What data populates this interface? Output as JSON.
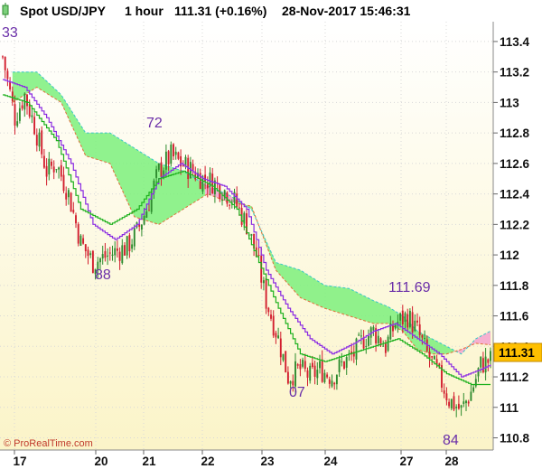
{
  "header": {
    "symbol": "Spot USD/JPY",
    "timeframe": "1 hour",
    "price_change": "111.31 (+0.16%)",
    "datetime": "28-Nov-2017 15:46:31"
  },
  "copyright": "© ProRealTime.com",
  "colors": {
    "candle_up": "#2e8b2e",
    "candle_down": "#d21e2e",
    "cloud_bull": "#7cf07c",
    "cloud_bear": "#f5a3cf",
    "tenkan": "#8a2be2",
    "kijun": "#1db01d",
    "last_price_bg": "#ffc000",
    "annotation": "#6a2ea8"
  },
  "chart_data": {
    "type": "line",
    "subtype": "candlestick with Ichimoku cloud",
    "y_ticks": [
      "113.4",
      "113.2",
      "113",
      "112.8",
      "112.6",
      "112.4",
      "112.2",
      "112",
      "111.8",
      "111.6",
      "111.4",
      "111.2",
      "111",
      "110.8"
    ],
    "ylim": [
      110.72,
      113.53
    ],
    "x_ticks": [
      "17",
      "20",
      "21",
      "22",
      "23",
      "24",
      "27",
      "28"
    ],
    "last_price": "111.31",
    "annotations": [
      "33",
      "72",
      "88",
      "07",
      "111.69",
      "84"
    ],
    "close_path": [
      [
        0,
        113.3
      ],
      [
        5,
        112.9
      ],
      [
        9,
        113.05
      ],
      [
        13,
        112.85
      ],
      [
        18,
        112.55
      ],
      [
        22,
        112.6
      ],
      [
        27,
        112.4
      ],
      [
        32,
        112.08
      ],
      [
        37,
        111.95
      ],
      [
        41,
        111.98
      ],
      [
        46,
        112.02
      ],
      [
        51,
        112.05
      ],
      [
        55,
        112.15
      ],
      [
        59,
        112.3
      ],
      [
        64,
        112.55
      ],
      [
        69,
        112.65
      ],
      [
        73,
        112.6
      ],
      [
        78,
        112.55
      ],
      [
        82,
        112.5
      ],
      [
        86,
        112.48
      ],
      [
        91,
        112.42
      ],
      [
        95,
        112.35
      ],
      [
        100,
        112.2
      ],
      [
        104,
        112.0
      ],
      [
        108,
        111.7
      ],
      [
        113,
        111.45
      ],
      [
        117,
        111.2
      ],
      [
        122,
        111.25
      ],
      [
        126,
        111.2
      ],
      [
        130,
        111.25
      ],
      [
        135,
        111.2
      ],
      [
        139,
        111.28
      ],
      [
        144,
        111.35
      ],
      [
        148,
        111.45
      ],
      [
        152,
        111.5
      ],
      [
        157,
        111.4
      ],
      [
        161,
        111.55
      ],
      [
        166,
        111.6
      ],
      [
        170,
        111.5
      ],
      [
        174,
        111.35
      ],
      [
        179,
        111.2
      ],
      [
        183,
        111.05
      ],
      [
        188,
        110.98
      ],
      [
        192,
        111.1
      ],
      [
        196,
        111.28
      ],
      [
        200,
        111.31
      ]
    ],
    "tenkan_path": [
      [
        0,
        113.15
      ],
      [
        9,
        113.1
      ],
      [
        18,
        112.9
      ],
      [
        28,
        112.6
      ],
      [
        37,
        112.2
      ],
      [
        46,
        112.1
      ],
      [
        55,
        112.2
      ],
      [
        64,
        112.5
      ],
      [
        73,
        112.6
      ],
      [
        82,
        112.5
      ],
      [
        91,
        112.45
      ],
      [
        100,
        112.3
      ],
      [
        108,
        111.9
      ],
      [
        117,
        111.65
      ],
      [
        126,
        111.45
      ],
      [
        135,
        111.35
      ],
      [
        144,
        111.42
      ],
      [
        152,
        111.5
      ],
      [
        161,
        111.55
      ],
      [
        170,
        111.45
      ],
      [
        179,
        111.35
      ],
      [
        188,
        111.2
      ],
      [
        196,
        111.25
      ],
      [
        200,
        111.28
      ]
    ],
    "kijun_path": [
      [
        0,
        113.05
      ],
      [
        10,
        113.0
      ],
      [
        22,
        112.75
      ],
      [
        32,
        112.3
      ],
      [
        44,
        112.2
      ],
      [
        55,
        112.3
      ],
      [
        64,
        112.5
      ],
      [
        74,
        112.55
      ],
      [
        86,
        112.45
      ],
      [
        96,
        112.3
      ],
      [
        105,
        111.95
      ],
      [
        113,
        111.65
      ],
      [
        122,
        111.35
      ],
      [
        132,
        111.3
      ],
      [
        142,
        111.35
      ],
      [
        152,
        111.4
      ],
      [
        162,
        111.45
      ],
      [
        172,
        111.35
      ],
      [
        182,
        111.22
      ],
      [
        192,
        111.15
      ],
      [
        200,
        111.15
      ]
    ],
    "cloud_top_path": [
      [
        4,
        113.2
      ],
      [
        14,
        113.2
      ],
      [
        24,
        113.05
      ],
      [
        34,
        112.8
      ],
      [
        44,
        112.8
      ],
      [
        54,
        112.7
      ],
      [
        64,
        112.6
      ],
      [
        74,
        112.55
      ],
      [
        84,
        112.45
      ],
      [
        92,
        112.4
      ],
      [
        102,
        112.3
      ],
      [
        112,
        111.95
      ],
      [
        122,
        111.9
      ],
      [
        132,
        111.8
      ],
      [
        142,
        111.78
      ],
      [
        152,
        111.7
      ],
      [
        158,
        111.66
      ],
      [
        164,
        111.6
      ],
      [
        170,
        111.5
      ],
      [
        176,
        111.45
      ],
      [
        182,
        111.4
      ],
      [
        188,
        111.35
      ],
      [
        194,
        111.45
      ],
      [
        200,
        111.5
      ]
    ],
    "cloud_bot_path": [
      [
        4,
        113.0
      ],
      [
        14,
        113.1
      ],
      [
        24,
        113.0
      ],
      [
        34,
        112.65
      ],
      [
        44,
        112.6
      ],
      [
        54,
        112.25
      ],
      [
        64,
        112.2
      ],
      [
        74,
        112.3
      ],
      [
        84,
        112.4
      ],
      [
        92,
        112.35
      ],
      [
        102,
        112.32
      ],
      [
        112,
        111.9
      ],
      [
        122,
        111.72
      ],
      [
        132,
        111.65
      ],
      [
        142,
        111.6
      ],
      [
        152,
        111.55
      ],
      [
        158,
        111.55
      ],
      [
        164,
        111.5
      ],
      [
        170,
        111.38
      ],
      [
        176,
        111.35
      ],
      [
        182,
        111.35
      ],
      [
        188,
        111.38
      ],
      [
        194,
        111.42
      ],
      [
        200,
        111.41
      ]
    ],
    "bear_cloud_ranges": [
      [
        84,
        96
      ],
      [
        186,
        200
      ]
    ],
    "grid": true
  }
}
